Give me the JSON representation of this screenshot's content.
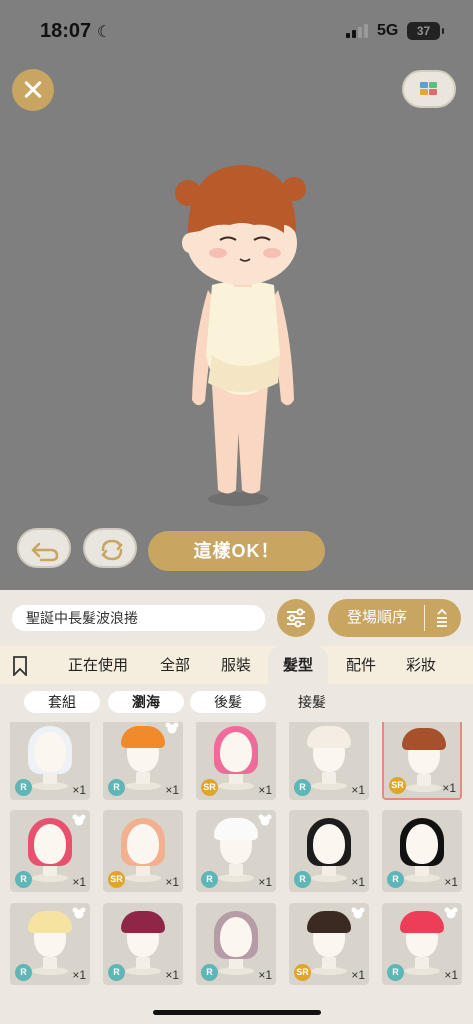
{
  "status_bar": {
    "time": "18:07",
    "network": "5G",
    "battery": "37"
  },
  "colors": {
    "gold": "#c8a560",
    "background": "#7f7f7f",
    "panel": "#ece8e1",
    "badge_r": "#5fb6b8",
    "badge_sr": "#e0a52a"
  },
  "toolbar": {
    "close_icon": "close-icon",
    "cube_icon": "color-cube-icon"
  },
  "actions": {
    "undo_icon": "undo-icon",
    "reset_icon": "refresh-icon",
    "ok_label": "這樣OK！"
  },
  "search": {
    "value": "聖誕中長髮波浪捲"
  },
  "sort": {
    "label": "登場順序"
  },
  "tabs": [
    "正在使用",
    "全部",
    "服裝",
    "髮型",
    "配件",
    "彩妝"
  ],
  "active_tab": "髮型",
  "subtabs": [
    "套組",
    "瀏海",
    "後髮",
    "接髮"
  ],
  "active_subtab": "瀏海",
  "items": [
    {
      "rarity": "R",
      "qty": "×1",
      "hair": "white-wavy"
    },
    {
      "rarity": "R",
      "qty": "×1",
      "hair": "orange-short",
      "bear": true
    },
    {
      "rarity": "SR",
      "qty": "×1",
      "hair": "pink-twin"
    },
    {
      "rarity": "R",
      "qty": "×1",
      "hair": "cream-bun"
    },
    {
      "rarity": "SR",
      "qty": "×1",
      "hair": "brown-bob",
      "selected": true
    },
    {
      "rarity": "R",
      "qty": "×1",
      "hair": "pink-pony",
      "bear": true
    },
    {
      "rarity": "SR",
      "qty": "×1",
      "hair": "peach-long"
    },
    {
      "rarity": "R",
      "qty": "×1",
      "hair": "white-spiky",
      "bear": true
    },
    {
      "rarity": "R",
      "qty": "×1",
      "hair": "black-straight"
    },
    {
      "rarity": "R",
      "qty": "×1",
      "hair": "black-long"
    },
    {
      "rarity": "R",
      "qty": "×1",
      "hair": "blonde-black",
      "bear": true
    },
    {
      "rarity": "R",
      "qty": "×1",
      "hair": "maroon-bob"
    },
    {
      "rarity": "R",
      "qty": "×1",
      "hair": "mauve-wavy"
    },
    {
      "rarity": "SR",
      "qty": "×1",
      "hair": "brown-pigtails",
      "bear": true
    },
    {
      "rarity": "R",
      "qty": "×1",
      "hair": "red-bear",
      "bear": true
    }
  ]
}
